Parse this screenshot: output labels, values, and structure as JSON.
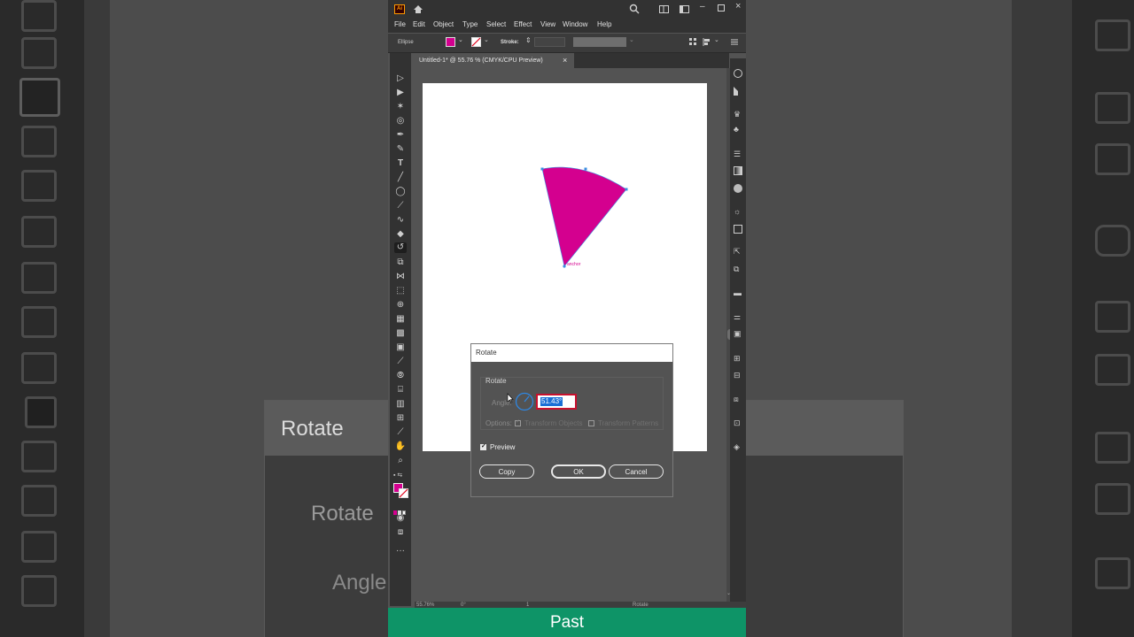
{
  "menu": {
    "items": [
      "File",
      "Edit",
      "Object",
      "Type",
      "Select",
      "Effect",
      "View",
      "Window",
      "Help"
    ]
  },
  "control": {
    "object_type": "Ellipse",
    "stroke_label": "Stroke:"
  },
  "document": {
    "tab_title": "Untitled-1* @ 55.76 % (CMYK/CPU Preview)",
    "close": "×"
  },
  "artwork": {
    "fill_color": "#d4008f",
    "anchor_label": "anchor"
  },
  "dialog": {
    "title": "Rotate",
    "section_label": "Rotate",
    "angle_label": "Angle:",
    "angle_value": "51.43°",
    "options_label": "Options:",
    "transform_objects": "Transform Objects",
    "transform_patterns": "Transform Patterns",
    "preview_label": "Preview",
    "preview_checked": true,
    "copy_button": "Copy",
    "ok_button": "OK",
    "cancel_button": "Cancel"
  },
  "statusbar": {
    "zoom": "55.76%",
    "angle": "0°",
    "artboard": "1",
    "tool": "Rotate"
  },
  "caption": {
    "text": "Past"
  },
  "background": {
    "dialog_title": "Rotate",
    "section_label": "Rotate",
    "angle_label": "Angle"
  },
  "colors": {
    "accent_magenta": "#d4008f",
    "caption_green": "#0e9467",
    "highlight_red": "#c8102e",
    "selection_blue": "#1a6fd6"
  }
}
